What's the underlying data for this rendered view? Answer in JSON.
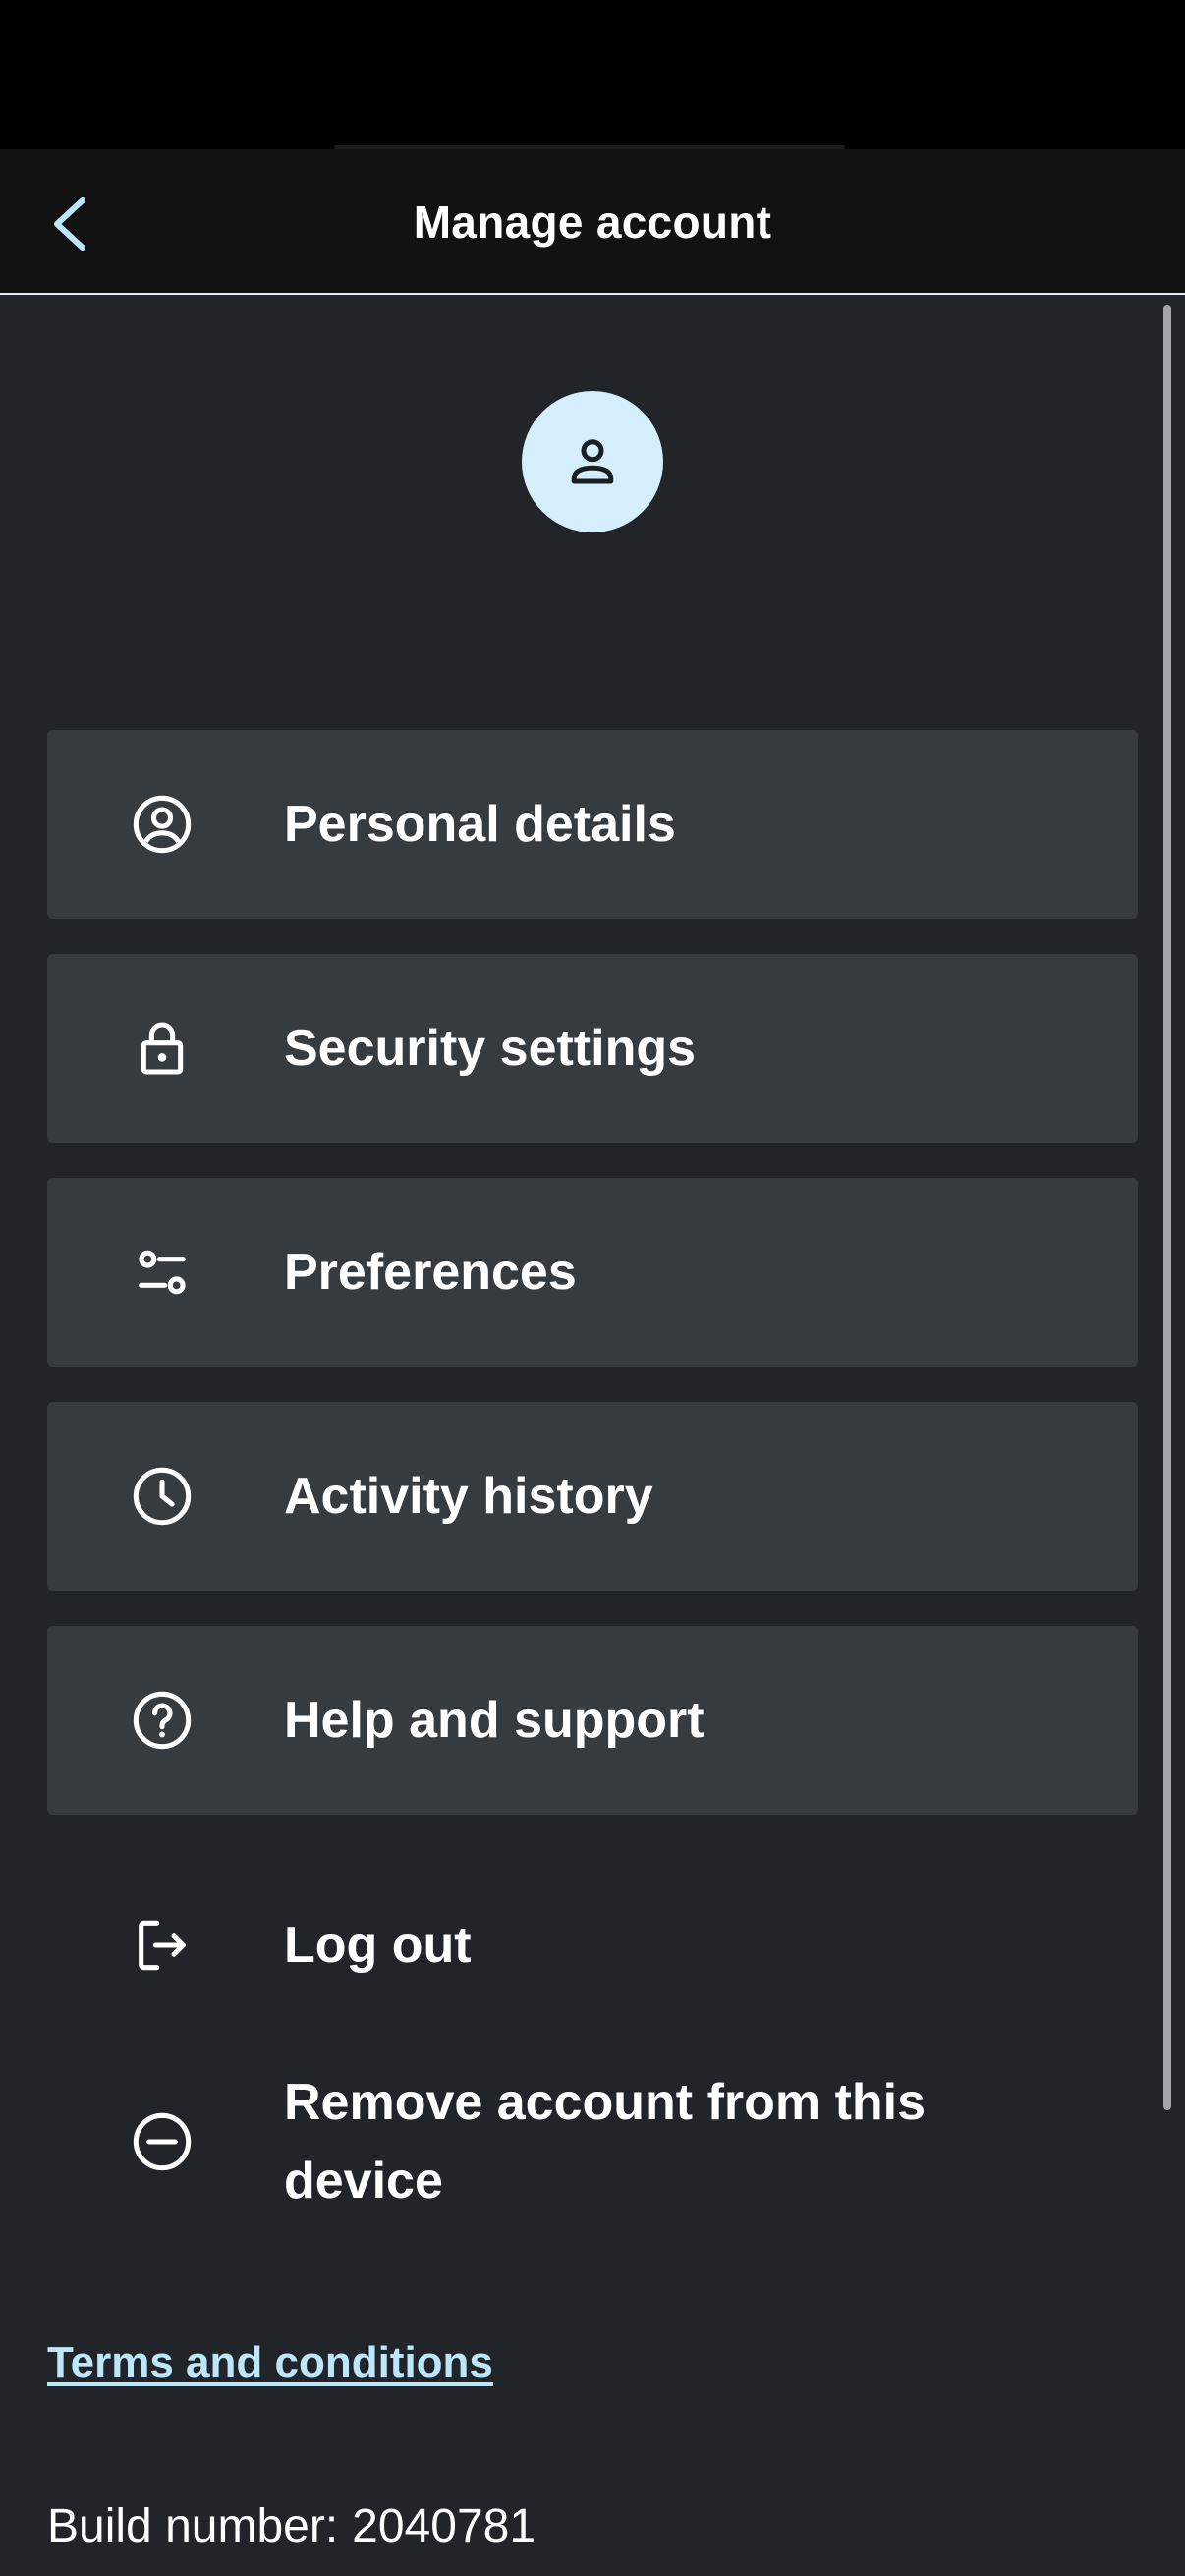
{
  "header": {
    "title": "Manage account",
    "back_icon": "chevron-left-icon"
  },
  "avatar": {
    "icon": "user-icon",
    "background": "#d4eefc"
  },
  "menu": {
    "cards": [
      {
        "label": "Personal details",
        "icon": "user-circle-icon"
      },
      {
        "label": "Security settings",
        "icon": "lock-icon"
      },
      {
        "label": "Preferences",
        "icon": "sliders-icon"
      },
      {
        "label": "Activity history",
        "icon": "clock-icon"
      },
      {
        "label": "Help and support",
        "icon": "help-circle-icon"
      }
    ],
    "actions": [
      {
        "label": "Log out",
        "icon": "logout-icon"
      },
      {
        "label": "Remove account from this device",
        "icon": "minus-circle-icon"
      }
    ]
  },
  "footer": {
    "terms_label": "Terms and conditions",
    "build_label": "Build number:",
    "build_value": "2040781"
  },
  "colors": {
    "background": "#212529",
    "card": "#363b40",
    "header": "#121212",
    "accent": "#bde6fb"
  }
}
